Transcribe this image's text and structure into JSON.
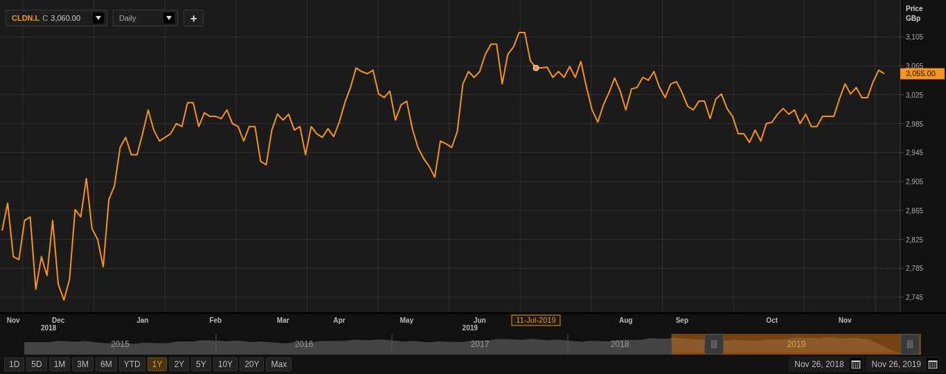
{
  "toolbar": {
    "price_prefix": "C",
    "price": "3,060.00",
    "interval": "Daily",
    "add_button": "+"
  },
  "chart": {
    "axis_title": "Price",
    "axis_unit": "GBp",
    "last_price_label": "3,055.00",
    "crosshair_label": "11-Jul-2019",
    "year_labels": [
      "2018",
      "2019"
    ],
    "chart_data": {
      "type": "line",
      "grid": true,
      "ylim": [
        2723,
        3156
      ],
      "yticks": [
        {
          "value": 2745,
          "label": "2,745"
        },
        {
          "value": 2785,
          "label": "2,785"
        },
        {
          "value": 2825,
          "label": "2,825"
        },
        {
          "value": 2865,
          "label": "2,865"
        },
        {
          "value": 2905,
          "label": "2,905"
        },
        {
          "value": 2945,
          "label": "2,945"
        },
        {
          "value": 2985,
          "label": "2,985"
        },
        {
          "value": 3025,
          "label": "3,025"
        },
        {
          "value": 3065,
          "label": "3,065"
        },
        {
          "value": 3105,
          "label": "3,105"
        }
      ],
      "categories": [
        null,
        null,
        "Nov",
        null,
        null,
        null,
        null,
        null,
        null,
        null,
        "Dec",
        null,
        null,
        null,
        null,
        null,
        null,
        null,
        null,
        null,
        null,
        null,
        null,
        null,
        null,
        "Jan",
        null,
        null,
        null,
        null,
        null,
        null,
        null,
        null,
        null,
        null,
        null,
        null,
        "Feb",
        null,
        null,
        null,
        null,
        null,
        null,
        null,
        null,
        null,
        null,
        null,
        "Mar",
        null,
        null,
        null,
        null,
        null,
        null,
        null,
        null,
        null,
        "Apr",
        null,
        null,
        null,
        null,
        null,
        null,
        null,
        null,
        null,
        null,
        null,
        "May",
        null,
        null,
        null,
        null,
        null,
        null,
        null,
        null,
        null,
        null,
        null,
        null,
        "Jun",
        null,
        null,
        null,
        null,
        null,
        null,
        null,
        null,
        null,
        null,
        null,
        null,
        null,
        null,
        null,
        null,
        null,
        null,
        null,
        null,
        null,
        null,
        null,
        null,
        null,
        "Aug",
        null,
        null,
        null,
        null,
        null,
        null,
        null,
        null,
        null,
        "Sep",
        null,
        null,
        null,
        null,
        null,
        null,
        null,
        null,
        null,
        null,
        null,
        null,
        null,
        null,
        null,
        "Oct",
        null,
        null,
        null,
        null,
        null,
        null,
        null,
        null,
        null,
        null,
        null,
        null,
        "Nov",
        null,
        null,
        null,
        null,
        null,
        null,
        null
      ],
      "series": [
        {
          "name": "CLDN.L",
          "color": "#f7941d",
          "values": [
            2837,
            2875,
            2801,
            2797,
            2851,
            2856,
            2756,
            2801,
            2775,
            2851,
            2763,
            2741,
            2770,
            2866,
            2856,
            2909,
            2840,
            2825,
            2787,
            2880,
            2899,
            2952,
            2966,
            2942,
            2942,
            2971,
            3004,
            2976,
            2961,
            2966,
            2971,
            2985,
            2981,
            3014,
            3014,
            2981,
            3000,
            2995,
            2995,
            2992,
            3004,
            2985,
            2981,
            2961,
            2981,
            2981,
            2933,
            2928,
            2976,
            2998,
            2990,
            2998,
            2976,
            2981,
            2942,
            2981,
            2971,
            2966,
            2978,
            2967,
            2987,
            3014,
            3035,
            3062,
            3057,
            3054,
            3059,
            3026,
            3021,
            3030,
            2990,
            3011,
            3016,
            2978,
            2952,
            2937,
            2926,
            2911,
            2961,
            2957,
            2952,
            2974,
            3040,
            3057,
            3049,
            3057,
            3081,
            3095,
            3095,
            3040,
            3081,
            3091,
            3111,
            3111,
            3072,
            3062,
            3062,
            3063,
            3049,
            3057,
            3049,
            3064,
            3049,
            3071,
            3035,
            3004,
            2987,
            3011,
            3028,
            3048,
            3030,
            3004,
            3033,
            3035,
            3049,
            3045,
            3057,
            3035,
            3021,
            3040,
            3043,
            3028,
            3009,
            3004,
            3016,
            3016,
            2992,
            3019,
            3026,
            3006,
            2995,
            2971,
            2971,
            2959,
            2976,
            2961,
            2985,
            2987,
            2998,
            3006,
            2998,
            3004,
            2985,
            2998,
            2981,
            2981,
            2995,
            2995,
            2995,
            3019,
            3040,
            3026,
            3035,
            3021,
            3021,
            3043,
            3059,
            3054
          ]
        }
      ]
    }
  },
  "navigator": {
    "years": [
      {
        "label": "2015",
        "selected": false
      },
      {
        "label": "2016",
        "selected": false
      },
      {
        "label": "2017",
        "selected": false
      },
      {
        "label": "2018",
        "selected": false
      },
      {
        "label": "2019",
        "selected": true
      }
    ]
  },
  "ranges": [
    {
      "label": "1D",
      "selected": false
    },
    {
      "label": "5D",
      "selected": false
    },
    {
      "label": "1M",
      "selected": false
    },
    {
      "label": "3M",
      "selected": false
    },
    {
      "label": "6M",
      "selected": false
    },
    {
      "label": "YTD",
      "selected": false
    },
    {
      "label": "1Y",
      "selected": true
    },
    {
      "label": "2Y",
      "selected": false
    },
    {
      "label": "5Y",
      "selected": false
    },
    {
      "label": "10Y",
      "selected": false
    },
    {
      "label": "20Y",
      "selected": false
    },
    {
      "label": "Max",
      "selected": false
    }
  ],
  "date_range": {
    "start": "Nov 26, 2018",
    "end": "Nov 26, 2019"
  }
}
